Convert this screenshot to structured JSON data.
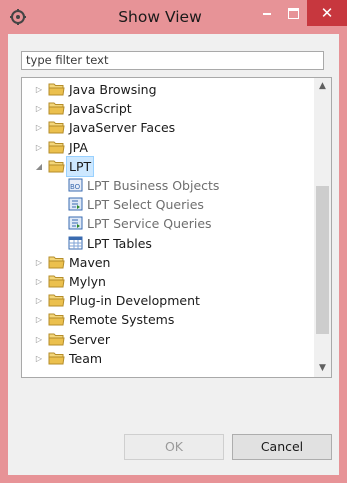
{
  "window": {
    "title": "Show View"
  },
  "filter": {
    "placeholder": "type filter text"
  },
  "tree": {
    "items": [
      {
        "label": "Java Browsing"
      },
      {
        "label": "JavaScript"
      },
      {
        "label": "JavaServer Faces"
      },
      {
        "label": "JPA"
      },
      {
        "label": "LPT",
        "expanded": true,
        "selected": true,
        "children": [
          {
            "label": "LPT Business Objects",
            "icon": "business-objects-icon"
          },
          {
            "label": "LPT Select Queries",
            "icon": "query-icon"
          },
          {
            "label": "LPT Service Queries",
            "icon": "query-icon"
          },
          {
            "label": "LPT Tables",
            "icon": "table-icon"
          }
        ]
      },
      {
        "label": "Maven"
      },
      {
        "label": "Mylyn"
      },
      {
        "label": "Plug-in Development"
      },
      {
        "label": "Remote Systems"
      },
      {
        "label": "Server"
      },
      {
        "label": "Team"
      }
    ]
  },
  "buttons": {
    "ok": "OK",
    "cancel": "Cancel"
  },
  "colors": {
    "title_bg": "#e79397",
    "close_bg": "#c7373e",
    "folder": "#e8c05a",
    "selection": "#cde8ff"
  }
}
